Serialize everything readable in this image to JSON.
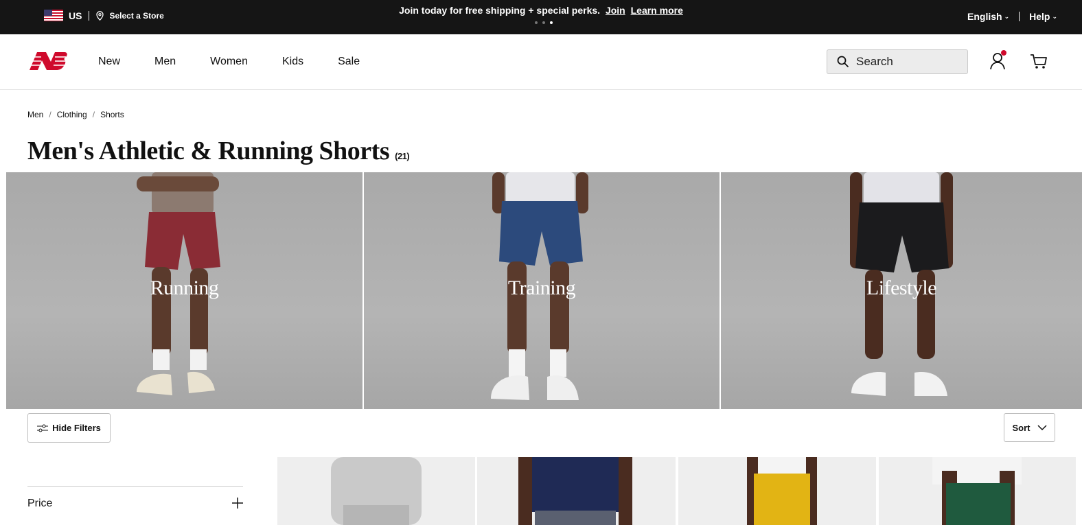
{
  "promo": {
    "country": "US",
    "store_label": "Select a Store",
    "message": "Join today for free shipping + special perks.",
    "join_link": "Join",
    "learn_link": "Learn more",
    "language": "English",
    "help": "Help"
  },
  "header": {
    "nav": [
      "New",
      "Men",
      "Women",
      "Kids",
      "Sale"
    ],
    "search_placeholder": "Search",
    "brand_color": "#cf0a2c"
  },
  "breadcrumb": [
    "Men",
    "Clothing",
    "Shorts"
  ],
  "page": {
    "title": "Men's Athletic & Running Shorts",
    "count": "(21)"
  },
  "categories": [
    {
      "label": "Running",
      "shorts_color": "#8a2c35",
      "shirt_color": "#8c7a70"
    },
    {
      "label": "Training",
      "shorts_color": "#2c4a7c",
      "shirt_color": "#e6e6ea"
    },
    {
      "label": "Lifestyle",
      "shorts_color": "#1b1b1d",
      "shirt_color": "#e3e3e8"
    }
  ],
  "toolbar": {
    "hide_filters": "Hide Filters",
    "sort": "Sort"
  },
  "filters": {
    "price": "Price"
  },
  "products": [
    {
      "color": "#c9c9c9"
    },
    {
      "color": "#1f2a55"
    },
    {
      "color": "#e2b414"
    },
    {
      "color": "#1f5a3e"
    }
  ]
}
